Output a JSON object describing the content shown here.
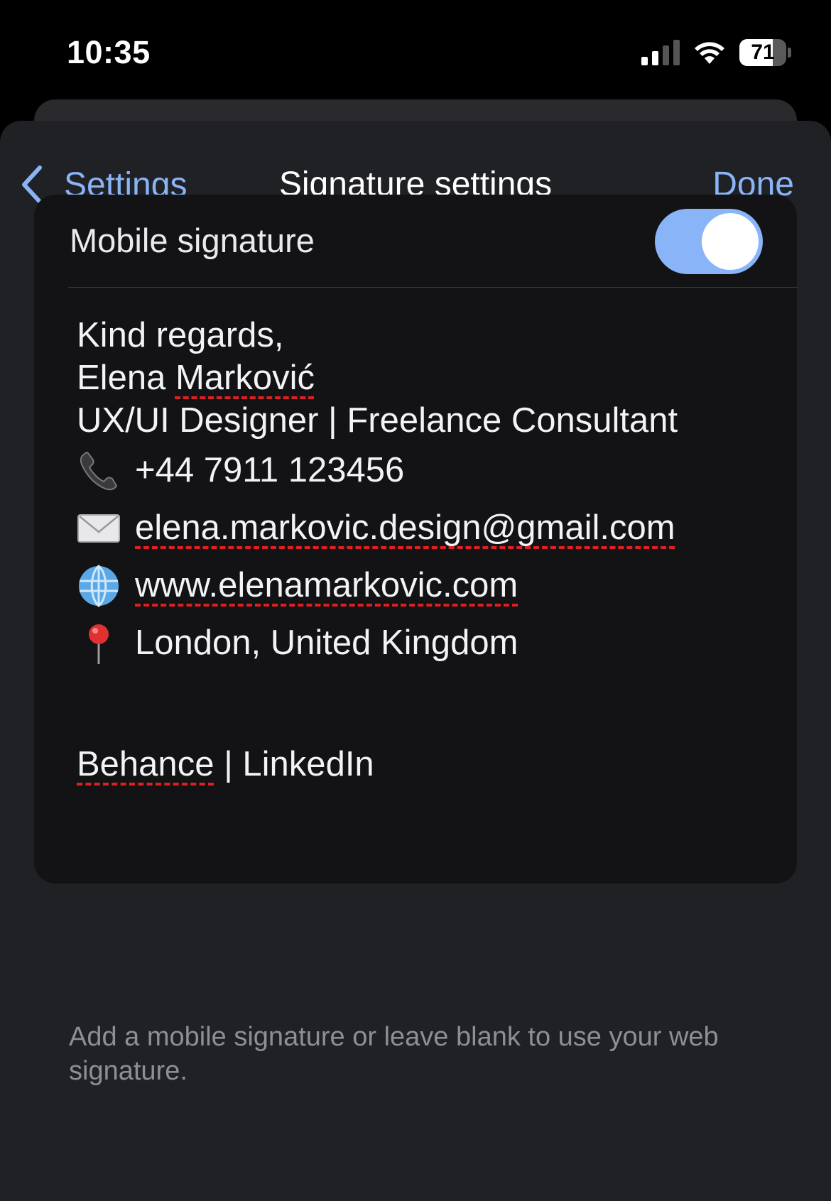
{
  "status_bar": {
    "time": "10:35",
    "battery_level": "71",
    "battery_fraction": 0.71
  },
  "nav": {
    "back_label": "Settings",
    "title": "Signature settings",
    "done_label": "Done"
  },
  "toggle": {
    "label": "Mobile signature",
    "on": true
  },
  "signature": {
    "line1": "Kind regards,",
    "name_first": "Elena ",
    "name_last": "Marković",
    "role": "UX/UI Designer | Freelance Consultant",
    "phone": "+44 7911 123456",
    "email": "elena.markovic.design@gmail.com",
    "website": "www.elenamarkovic.com",
    "location": "London, United Kingdom",
    "social_behance": "Behance",
    "social_sep": " | ",
    "social_linkedin": "LinkedIn"
  },
  "footer_note": "Add a mobile signature or leave blank to use your web signature.",
  "colors": {
    "accent": "#8ab4f8",
    "sheet_bg": "#202124",
    "card_bg": "#131316",
    "spellcheck": "#e02020"
  },
  "icons": [
    "back-chevron-icon",
    "phone-icon",
    "envelope-icon",
    "globe-icon",
    "pin-icon",
    "signal-icon",
    "wifi-icon",
    "battery-icon"
  ]
}
